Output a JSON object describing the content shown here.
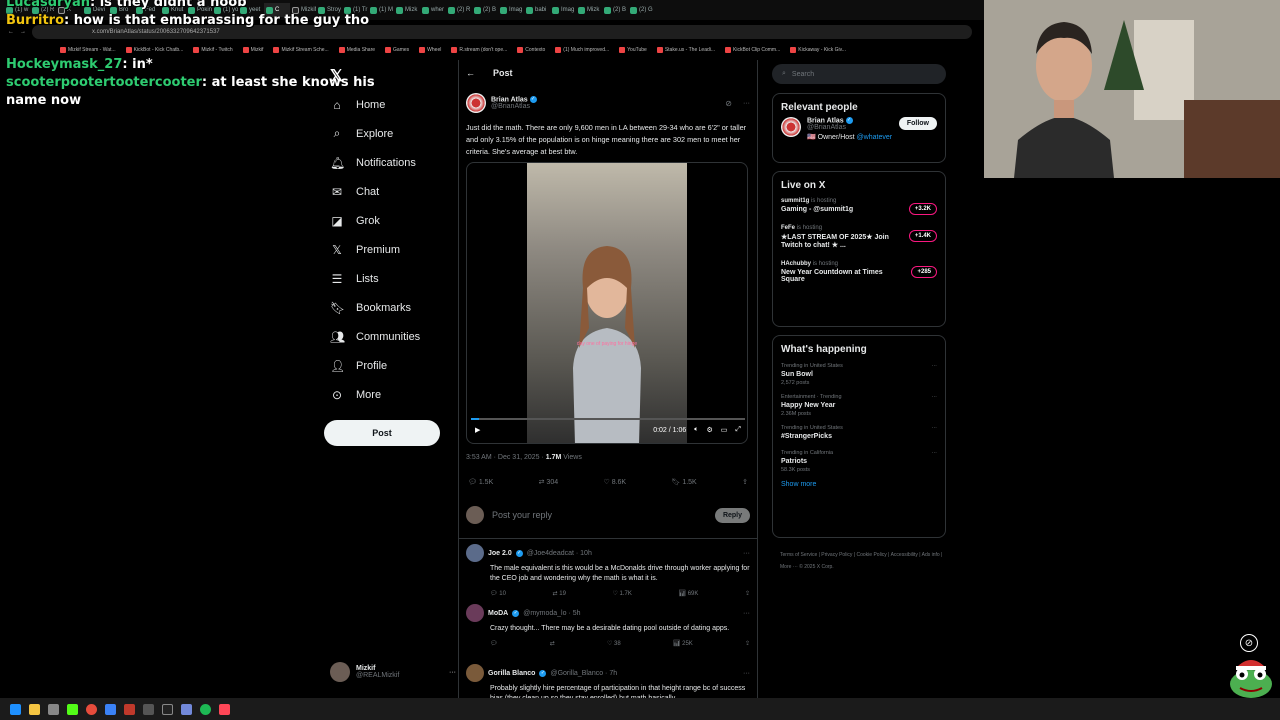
{
  "browser": {
    "tabs": [
      "(1) w",
      "(2) R",
      "X",
      "Devi",
      "Bro",
      "Fed",
      "Knut",
      "Pokin",
      "(1) yo",
      "yeet",
      "C",
      "Mizkif",
      "Stroy",
      "(1) Tr",
      "(1) M",
      "Mizk",
      "wher",
      "(2) R",
      "(2) B",
      "Imag",
      "babi",
      "Imag",
      "Mizk",
      "(2) B",
      "(2) G"
    ],
    "url": "x.com/BrianAtlas/status/2006332709642371537",
    "bookmarks": [
      "Mizkif Stream - Wat...",
      "KickBot - Kick Chatb...",
      "Mizkif - Twitch",
      "Mizkif",
      "Mizkif Stream Sche...",
      "Media Share",
      "Games",
      "Wheel",
      "R.stream (don't ope...",
      "Contexto",
      "(1) Much improved...",
      "YouTube",
      "Stake.us - The Leadi...",
      "KickBot Clip Comm...",
      "Kickaway - Kick Giv..."
    ]
  },
  "chat_overlay": [
    {
      "user": "Lucasdryan",
      "text": "is they didnt a noob"
    },
    {
      "user": "Burritro",
      "text": "how is that embarassing for the guy tho"
    },
    {
      "user": "Hockeymask_27",
      "text": "in*"
    },
    {
      "user": "scooterpootertootercooter",
      "text": "at least she knows his name now"
    }
  ],
  "nav": {
    "items": [
      {
        "label": "Home",
        "icon": "home-icon"
      },
      {
        "label": "Explore",
        "icon": "search-icon"
      },
      {
        "label": "Notifications",
        "icon": "bell-icon"
      },
      {
        "label": "Chat",
        "icon": "mail-icon"
      },
      {
        "label": "Grok",
        "icon": "grok-icon"
      },
      {
        "label": "Premium",
        "icon": "x-logo-icon"
      },
      {
        "label": "Lists",
        "icon": "list-icon"
      },
      {
        "label": "Bookmarks",
        "icon": "bookmark-icon"
      },
      {
        "label": "Communities",
        "icon": "people-icon"
      },
      {
        "label": "Profile",
        "icon": "person-icon"
      },
      {
        "label": "More",
        "icon": "more-circle-icon"
      }
    ],
    "post_button": "Post",
    "account": {
      "name": "Mizkif",
      "handle": "@REALMizkif"
    }
  },
  "post": {
    "header": "Post",
    "author": "Brian Atlas",
    "handle": "@BrianAtlas",
    "text": "Just did the math. There are only 9,600 men in LA between 29-34 who are 6'2\" or taller and only 3.15% of the population is on hinge meaning there are 302 men to meet her criteria. She's average at best btw.",
    "video_caption": "day one of paying for hinge",
    "video_time": "0:02 / 1:06",
    "video_progress": 0.03,
    "timestamp": "3:53 AM · Dec 31, 2025 · ",
    "views": "1.7M",
    "views_label": " Views",
    "stats": {
      "replies": "1.5K",
      "reposts": "304",
      "likes": "8.6K",
      "bookmarks": "1.5K"
    },
    "reply_placeholder": "Post your reply",
    "reply_button": "Reply"
  },
  "replies": [
    {
      "name": "Joe 2.0",
      "handle": "@Joe4deadcat · 10h",
      "text": "The male equivalent is this would be a McDonalds drive through worker applying for the CEO job and wondering why the math is what it is.",
      "replies": "10",
      "reposts": "19",
      "likes": "1.7K",
      "views": "69K"
    },
    {
      "name": "MoDA",
      "handle": "@mymoda_lo · 5h",
      "text": "Crazy thought... There may be a desirable dating pool outside of dating apps.",
      "replies": "",
      "reposts": "",
      "likes": "38",
      "views": "25K"
    },
    {
      "name": "Gorilla Blanco",
      "handle": "@Gorilla_Blanco · 7h",
      "text": "Probably slightly hire percentage of participation in that height range bc of success bias (they clean up so they stay enrolled) but math basically",
      "replies": "",
      "reposts": "",
      "likes": "",
      "views": ""
    }
  ],
  "sidebar": {
    "search_placeholder": "Search",
    "relevant_title": "Relevant people",
    "relevant": {
      "name": "Brian Atlas",
      "handle": "@BrianAtlas",
      "bio": "🇺🇸 Owner/Host ",
      "bio_link": "@whatever",
      "follow": "Follow"
    },
    "live_title": "Live on X",
    "live": [
      {
        "host": "summit1g",
        "hosting": " is hosting",
        "title": "Gaming - @summit1g",
        "count": "+3.2K"
      },
      {
        "host": "FeFe",
        "hosting": " is hosting",
        "title": "★LAST STREAM OF 2025★ Join Twitch to chat! ★ ...",
        "count": "+1.4K"
      },
      {
        "host": "HAchubby",
        "hosting": " is hosting",
        "title": "New Year Countdown at Times Square",
        "count": "+285"
      }
    ],
    "happening_title": "What's happening",
    "trends": [
      {
        "context": "Trending in United States",
        "name": "Sun Bowl",
        "posts": "2,572 posts"
      },
      {
        "context": "Entertainment · Trending",
        "name": "Happy New Year",
        "posts": "2.36M posts"
      },
      {
        "context": "Trending in United States",
        "name": "#StrangerPicks",
        "posts": ""
      },
      {
        "context": "Trending in California",
        "name": "Patriots",
        "posts": "58.3K posts"
      }
    ],
    "show_more": "Show more",
    "footer": "Terms of Service | Privacy Policy | Cookie Policy | Accessibility | Ads info | More ··· © 2025 X Corp."
  },
  "colors": {
    "accent": "#1d9bf0",
    "live_pink": "#f91880",
    "bg": "#000000"
  }
}
